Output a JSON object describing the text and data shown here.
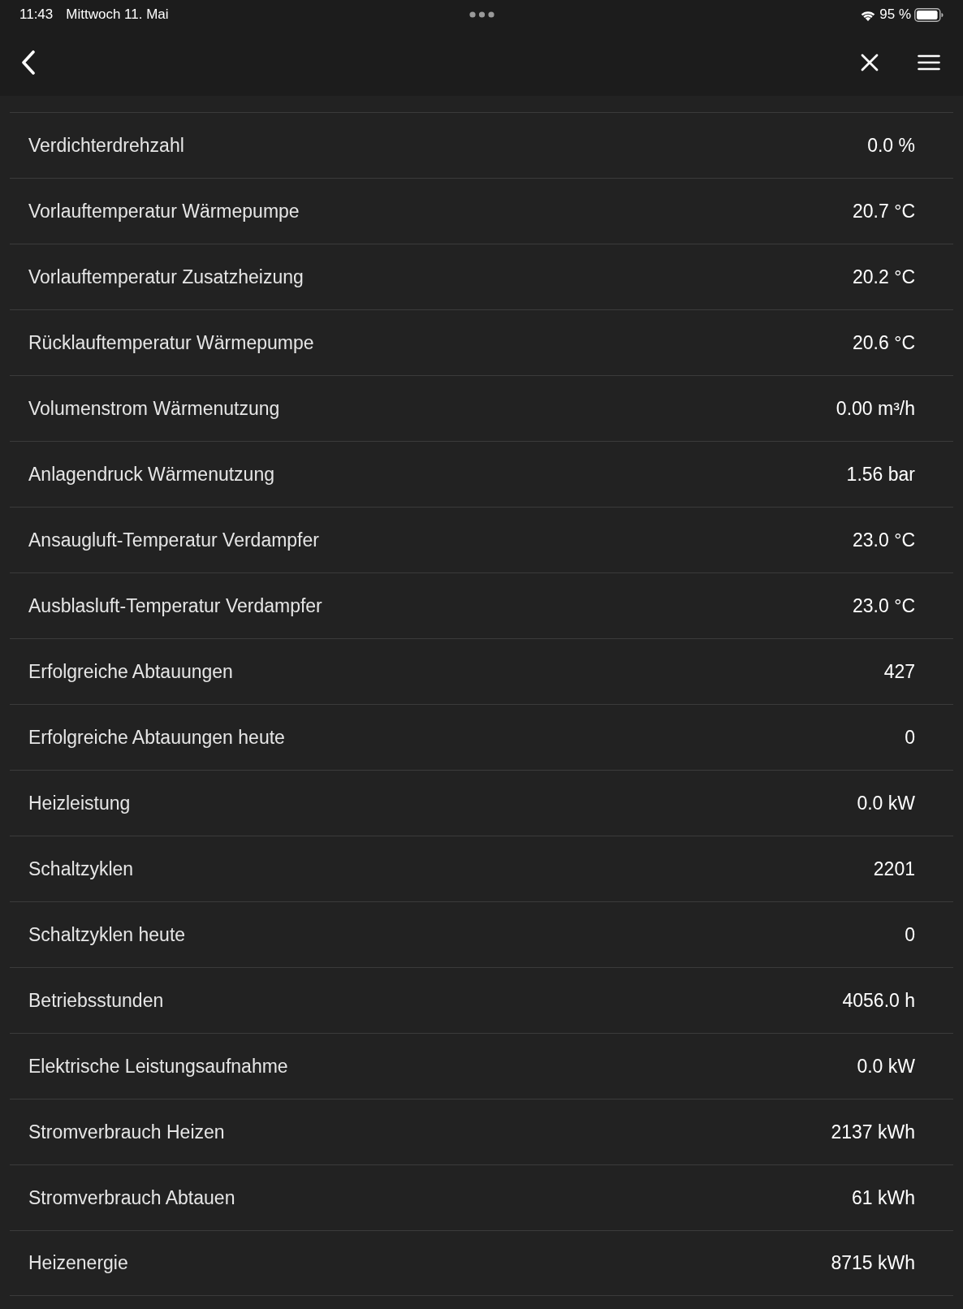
{
  "status_bar": {
    "time": "11:43",
    "date": "Mittwoch 11. Mai",
    "battery": "95 %"
  },
  "rows": [
    {
      "label": "Verdichterdrehzahl",
      "value": "0.0 %"
    },
    {
      "label": "Vorlauftemperatur Wärmepumpe",
      "value": "20.7 °C"
    },
    {
      "label": "Vorlauftemperatur Zusatzheizung",
      "value": "20.2 °C"
    },
    {
      "label": "Rücklauftemperatur Wärmepumpe",
      "value": "20.6 °C"
    },
    {
      "label": "Volumenstrom Wärmenutzung",
      "value": "0.00 m³/h"
    },
    {
      "label": "Anlagendruck Wärmenutzung",
      "value": "1.56 bar"
    },
    {
      "label": "Ansaugluft-Temperatur Verdampfer",
      "value": "23.0 °C"
    },
    {
      "label": "Ausblasluft-Temperatur Verdampfer",
      "value": "23.0 °C"
    },
    {
      "label": "Erfolgreiche Abtauungen",
      "value": "427"
    },
    {
      "label": "Erfolgreiche Abtauungen heute",
      "value": "0"
    },
    {
      "label": "Heizleistung",
      "value": "0.0 kW"
    },
    {
      "label": "Schaltzyklen",
      "value": "2201"
    },
    {
      "label": "Schaltzyklen heute",
      "value": "0"
    },
    {
      "label": "Betriebsstunden",
      "value": "4056.0 h"
    },
    {
      "label": "Elektrische Leistungsaufnahme",
      "value": "0.0 kW"
    },
    {
      "label": "Stromverbrauch Heizen",
      "value": "2137 kWh"
    },
    {
      "label": "Stromverbrauch Abtauen",
      "value": "61 kWh"
    },
    {
      "label": "Heizenergie",
      "value": "8715 kWh"
    }
  ]
}
